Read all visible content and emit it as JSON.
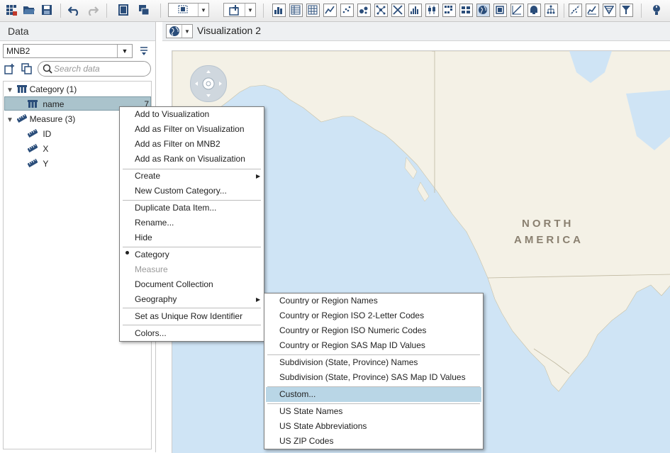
{
  "toolbar": {
    "object_selector_label": "",
    "icons": [
      "grid-app-icon",
      "open-folder-icon",
      "save-icon",
      "undo-icon",
      "redo-icon",
      "page-icon",
      "duplicate-icon",
      "select-object-icon",
      "add-object-icon",
      "bar-chart-icon",
      "table-icon",
      "crosstab-icon",
      "line-chart-icon",
      "scatter-icon",
      "bubble-icon",
      "network-icon",
      "treemap-icon",
      "histogram-icon",
      "box-plot-icon",
      "heatmap-icon",
      "geo-map-icon",
      "gauge-icon",
      "correlation-icon",
      "decision-tree-icon",
      "path-icon",
      "forecast-icon",
      "word-cloud-icon",
      "funnel-icon",
      "wizard-icon"
    ]
  },
  "data_pane": {
    "title": "Data",
    "source": "MNB2",
    "search_placeholder": "Search data",
    "tree": {
      "category_group": "Category (1)",
      "category_items": [
        {
          "label": "name",
          "count": "7"
        }
      ],
      "measure_group": "Measure (3)",
      "measure_items": [
        "ID",
        "X",
        "Y"
      ]
    }
  },
  "viz": {
    "title": "Visualization 2",
    "map_label_line1": "NORTH",
    "map_label_line2": "AMERICA"
  },
  "context_menu": {
    "items": [
      "Add to Visualization",
      "Add as Filter on Visualization",
      "Add as Filter on MNB2",
      "Add as Rank on Visualization",
      "Create",
      "New Custom Category...",
      "Duplicate Data Item...",
      "Rename...",
      "Hide",
      "Category",
      "Measure",
      "Document Collection",
      "Geography",
      "Set as Unique Row Identifier",
      "Colors..."
    ],
    "checked_item": "Category",
    "disabled_item": "Measure"
  },
  "geography_submenu": {
    "items": [
      "Country or Region Names",
      "Country or Region ISO 2-Letter Codes",
      "Country or Region ISO Numeric Codes",
      "Country or Region SAS Map ID Values",
      "Subdivision (State, Province) Names",
      "Subdivision (State, Province) SAS Map ID Values",
      "Custom...",
      "US State Names",
      "US State Abbreviations",
      "US ZIP Codes"
    ],
    "highlighted_item": "Custom..."
  },
  "colors": {
    "toolbar_icon_blue": "#2a4d7a",
    "selection": "#aac3cc",
    "menu_highlight": "#b9d6e6",
    "ocean": "#cfe4f5",
    "land": "#f4f1e6"
  }
}
